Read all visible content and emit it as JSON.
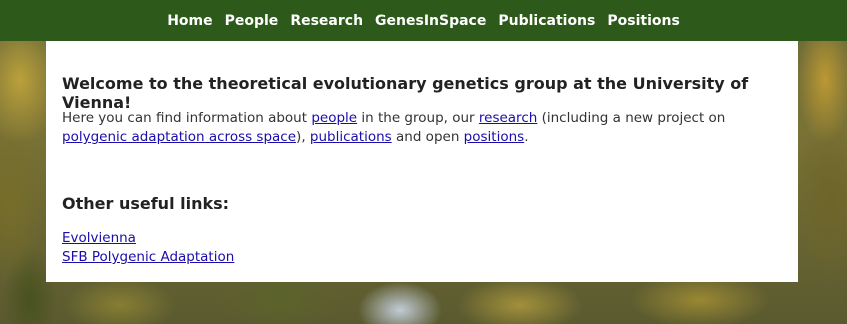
{
  "nav": {
    "items": [
      {
        "label": "Home"
      },
      {
        "label": "People"
      },
      {
        "label": "Research"
      },
      {
        "label": "GenesInSpace"
      },
      {
        "label": "Publications"
      },
      {
        "label": "Positions"
      }
    ]
  },
  "main": {
    "welcome_title": "Welcome to the theoretical evolutionary genetics group at the University of Vienna!",
    "intro": {
      "t1": "Here you can find information about ",
      "link_people": "people",
      "t2": " in the group, our ",
      "link_research": "research",
      "t3": " (including a new project on ",
      "link_polygenic": "polygenic adaptation across space",
      "t4": "), ",
      "link_publications": "publications",
      "t5": " and open ",
      "link_positions": "positions",
      "t6": "."
    },
    "other_links_heading": "Other useful links:",
    "other_links": [
      {
        "label": "Evolvienna"
      },
      {
        "label": "SFB Polygenic Adaptation"
      }
    ]
  },
  "colors": {
    "nav_background": "#2d5a1b",
    "link": "#1a0dab"
  }
}
